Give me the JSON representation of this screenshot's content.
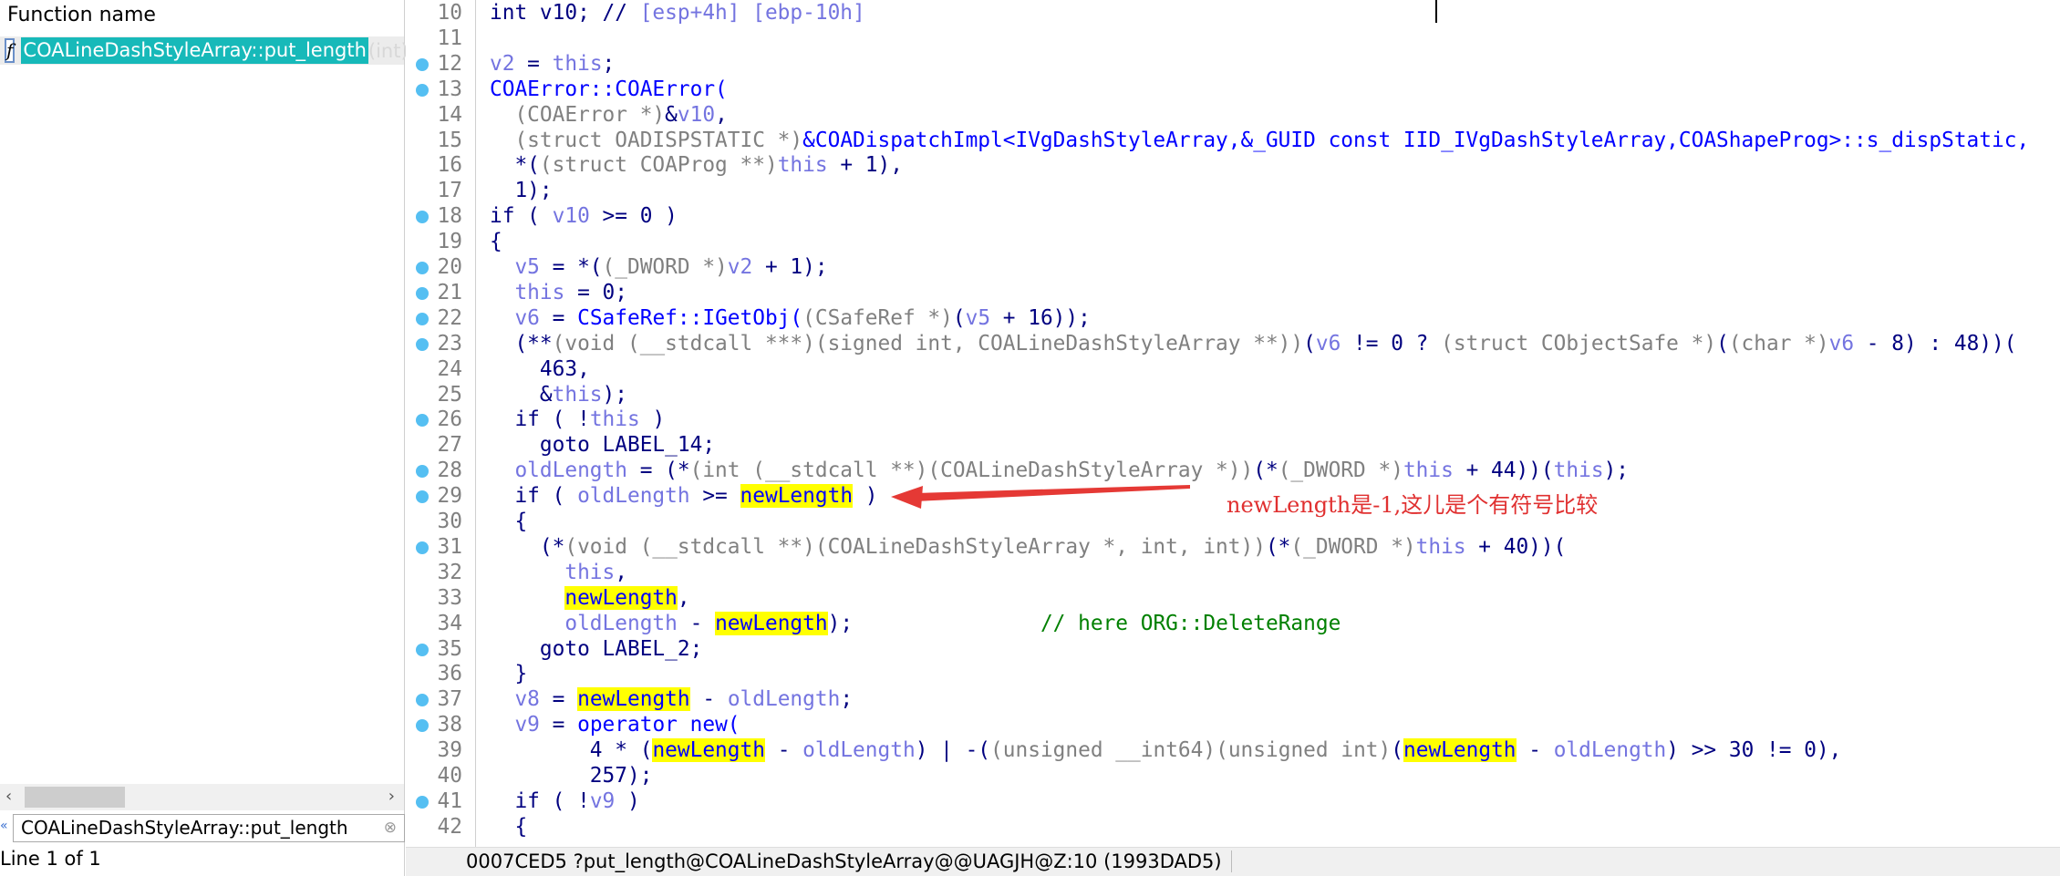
{
  "functions_panel": {
    "header": "Function name",
    "icon": "function-icon",
    "items": [
      {
        "name": "COALineDashStyleArray::put_length",
        "args": "(int)"
      }
    ],
    "search_value": "COALineDashStyleArray::put_length",
    "line_count": "Line 1 of 1"
  },
  "status_bar": {
    "text": "0007CED5 ?put_length@COALineDashStyleArray@@UAGJH@Z:10 (1993DAD5)"
  },
  "annotation": {
    "text": "newLength是-1,这儿是个有符号比较",
    "color": "#e03030"
  },
  "colors": {
    "keyword": "#000080",
    "variable": "#7474e0",
    "type": "#808080",
    "function": "#0000ff",
    "comment": "#008000",
    "highlight": "#ffff00",
    "selection": "#17b9b9",
    "breakpoint": "#55bff2"
  },
  "code": {
    "lines": [
      {
        "num": "10",
        "bp": false,
        "t": [
          [
            "n",
            "int v10; // "
          ],
          [
            "p",
            "[esp+4h] [ebp-10h]"
          ]
        ]
      },
      {
        "num": "11",
        "bp": false,
        "t": []
      },
      {
        "num": "12",
        "bp": true,
        "t": [
          [
            "p",
            "v2"
          ],
          [
            "n",
            " = "
          ],
          [
            "p",
            "this"
          ],
          [
            "n",
            ";"
          ]
        ]
      },
      {
        "num": "13",
        "bp": true,
        "t": [
          [
            "b",
            "COAError::COAError("
          ]
        ]
      },
      {
        "num": "14",
        "bp": false,
        "t": [
          [
            "n",
            "  "
          ],
          [
            "g",
            "(COAError *)"
          ],
          [
            "n",
            "&"
          ],
          [
            "p",
            "v10"
          ],
          [
            "n",
            ","
          ]
        ]
      },
      {
        "num": "15",
        "bp": false,
        "t": [
          [
            "n",
            "  "
          ],
          [
            "g",
            "(struct OADISPSTATIC *)"
          ],
          [
            "b",
            "&COADispatchImpl<IVgDashStyleArray,&_GUID const IID_IVgDashStyleArray,COAShapeProg>::s_dispStatic,"
          ]
        ]
      },
      {
        "num": "16",
        "bp": false,
        "t": [
          [
            "n",
            "  *("
          ],
          [
            "g",
            "(struct COAProg **)"
          ],
          [
            "p",
            "this"
          ],
          [
            "n",
            " + 1),"
          ]
        ]
      },
      {
        "num": "17",
        "bp": false,
        "t": [
          [
            "n",
            "  1);"
          ]
        ]
      },
      {
        "num": "18",
        "bp": true,
        "t": [
          [
            "n",
            "if ( "
          ],
          [
            "p",
            "v10"
          ],
          [
            "n",
            " >= 0 )"
          ]
        ]
      },
      {
        "num": "19",
        "bp": false,
        "t": [
          [
            "n",
            "{"
          ]
        ]
      },
      {
        "num": "20",
        "bp": true,
        "t": [
          [
            "n",
            "  "
          ],
          [
            "p",
            "v5"
          ],
          [
            "n",
            " = *("
          ],
          [
            "g",
            "(_DWORD *)"
          ],
          [
            "p",
            "v2"
          ],
          [
            "n",
            " + 1);"
          ]
        ]
      },
      {
        "num": "21",
        "bp": true,
        "t": [
          [
            "n",
            "  "
          ],
          [
            "p",
            "this"
          ],
          [
            "n",
            " = 0;"
          ]
        ]
      },
      {
        "num": "22",
        "bp": true,
        "t": [
          [
            "n",
            "  "
          ],
          [
            "p",
            "v6"
          ],
          [
            "n",
            " = "
          ],
          [
            "b",
            "CSafeRef::IGetObj("
          ],
          [
            "g",
            "(CSafeRef *)"
          ],
          [
            "n",
            "("
          ],
          [
            "p",
            "v5"
          ],
          [
            "n",
            " + 16));"
          ]
        ]
      },
      {
        "num": "23",
        "bp": true,
        "t": [
          [
            "n",
            "  (**"
          ],
          [
            "g",
            "(void (__stdcall ***)(signed int, COALineDashStyleArray **))"
          ],
          [
            "n",
            "("
          ],
          [
            "p",
            "v6"
          ],
          [
            "n",
            " != 0 ? "
          ],
          [
            "g",
            "(struct CObjectSafe *)"
          ],
          [
            "n",
            "("
          ],
          [
            "g",
            "(char *)"
          ],
          [
            "p",
            "v6"
          ],
          [
            "n",
            " - 8) : 48))("
          ]
        ]
      },
      {
        "num": "24",
        "bp": false,
        "t": [
          [
            "n",
            "    463,"
          ]
        ]
      },
      {
        "num": "25",
        "bp": false,
        "t": [
          [
            "n",
            "    &"
          ],
          [
            "p",
            "this"
          ],
          [
            "n",
            ");"
          ]
        ]
      },
      {
        "num": "26",
        "bp": true,
        "t": [
          [
            "n",
            "  if ( !"
          ],
          [
            "p",
            "this"
          ],
          [
            "n",
            " )"
          ]
        ]
      },
      {
        "num": "27",
        "bp": false,
        "t": [
          [
            "n",
            "    goto LABEL_14;"
          ]
        ]
      },
      {
        "num": "28",
        "bp": true,
        "t": [
          [
            "n",
            "  "
          ],
          [
            "p",
            "oldLength"
          ],
          [
            "n",
            " = (*"
          ],
          [
            "g",
            "(int (__stdcall **)(COALineDashStyleArray *))"
          ],
          [
            "n",
            "(*"
          ],
          [
            "g",
            "(_DWORD *)"
          ],
          [
            "p",
            "this"
          ],
          [
            "n",
            " + 44))("
          ],
          [
            "p",
            "this"
          ],
          [
            "n",
            ");"
          ]
        ]
      },
      {
        "num": "29",
        "bp": true,
        "t": [
          [
            "n",
            "  if ( "
          ],
          [
            "p",
            "oldLength"
          ],
          [
            "n",
            " >= "
          ],
          [
            "y",
            "newLength"
          ],
          [
            "n",
            " )"
          ]
        ]
      },
      {
        "num": "30",
        "bp": false,
        "t": [
          [
            "n",
            "  {"
          ]
        ]
      },
      {
        "num": "31",
        "bp": true,
        "t": [
          [
            "n",
            "    (*"
          ],
          [
            "g",
            "(void (__stdcall **)(COALineDashStyleArray *, int, int))"
          ],
          [
            "n",
            "(*"
          ],
          [
            "g",
            "(_DWORD *)"
          ],
          [
            "p",
            "this"
          ],
          [
            "n",
            " + 40))("
          ]
        ]
      },
      {
        "num": "32",
        "bp": false,
        "t": [
          [
            "n",
            "      "
          ],
          [
            "p",
            "this"
          ],
          [
            "n",
            ","
          ]
        ]
      },
      {
        "num": "33",
        "bp": false,
        "t": [
          [
            "n",
            "      "
          ],
          [
            "y",
            "newLength"
          ],
          [
            "n",
            ","
          ]
        ]
      },
      {
        "num": "34",
        "bp": false,
        "t": [
          [
            "n",
            "      "
          ],
          [
            "p",
            "oldLength"
          ],
          [
            "n",
            " - "
          ],
          [
            "y",
            "newLength"
          ],
          [
            "n",
            ");               "
          ],
          [
            "c",
            "// here ORG::DeleteRange"
          ]
        ]
      },
      {
        "num": "35",
        "bp": true,
        "t": [
          [
            "n",
            "    goto LABEL_2;"
          ]
        ]
      },
      {
        "num": "36",
        "bp": false,
        "t": [
          [
            "n",
            "  }"
          ]
        ]
      },
      {
        "num": "37",
        "bp": true,
        "t": [
          [
            "n",
            "  "
          ],
          [
            "p",
            "v8"
          ],
          [
            "n",
            " = "
          ],
          [
            "y",
            "newLength"
          ],
          [
            "n",
            " - "
          ],
          [
            "p",
            "oldLength"
          ],
          [
            "n",
            ";"
          ]
        ]
      },
      {
        "num": "38",
        "bp": true,
        "t": [
          [
            "n",
            "  "
          ],
          [
            "p",
            "v9"
          ],
          [
            "n",
            " = "
          ],
          [
            "b",
            "operator new("
          ]
        ]
      },
      {
        "num": "39",
        "bp": false,
        "t": [
          [
            "n",
            "        4 * ("
          ],
          [
            "y",
            "newLength"
          ],
          [
            "n",
            " - "
          ],
          [
            "p",
            "oldLength"
          ],
          [
            "n",
            ") | -("
          ],
          [
            "g",
            "(unsigned __int64)"
          ],
          [
            "g",
            "(unsigned int)"
          ],
          [
            "n",
            "("
          ],
          [
            "y",
            "newLength"
          ],
          [
            "n",
            " - "
          ],
          [
            "p",
            "oldLength"
          ],
          [
            "n",
            ") >> 30 != 0),"
          ]
        ]
      },
      {
        "num": "40",
        "bp": false,
        "t": [
          [
            "n",
            "        257);"
          ]
        ]
      },
      {
        "num": "41",
        "bp": true,
        "t": [
          [
            "n",
            "  if ( !"
          ],
          [
            "p",
            "v9"
          ],
          [
            "n",
            " )"
          ]
        ]
      },
      {
        "num": "42",
        "bp": false,
        "t": [
          [
            "n",
            "  {"
          ]
        ]
      }
    ]
  }
}
